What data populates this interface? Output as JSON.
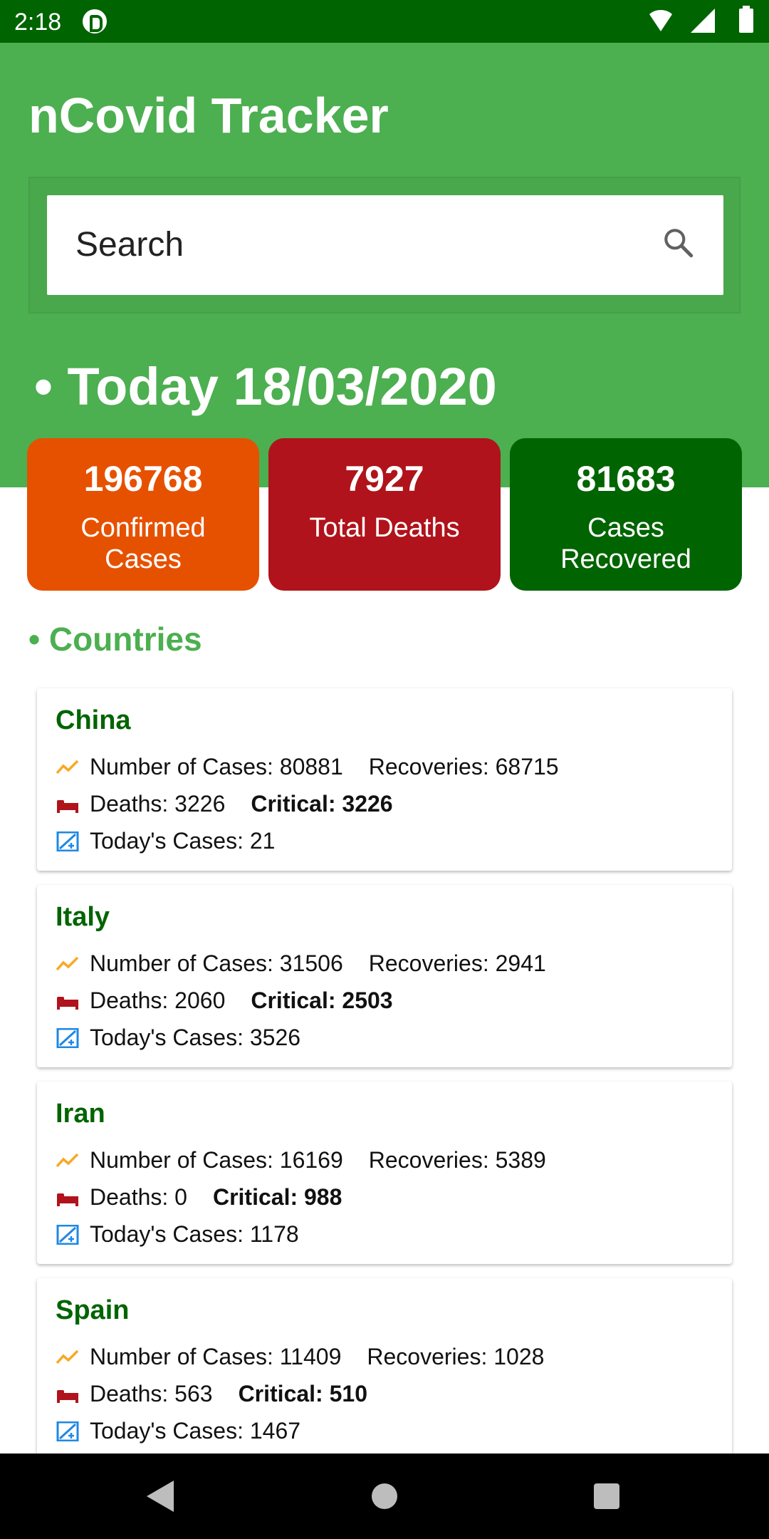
{
  "status_bar": {
    "time": "2:18"
  },
  "app": {
    "title": "nCovid Tracker"
  },
  "search": {
    "label": "Search"
  },
  "today": {
    "label": "• Today 18/03/2020"
  },
  "stats": {
    "confirmed": {
      "value": "196768",
      "label": "Confirmed Cases"
    },
    "deaths": {
      "value": "7927",
      "label": "Total Deaths"
    },
    "recovered": {
      "value": "81683",
      "label": "Cases Recovered"
    }
  },
  "countries_heading": "• Countries",
  "labels": {
    "cases": "Number of Cases:",
    "recoveries": "Recoveries:",
    "deaths": "Deaths:",
    "critical": "Critical:",
    "today": "Today's Cases:"
  },
  "countries": [
    {
      "name": "China",
      "cases": "80881",
      "recoveries": "68715",
      "deaths": "3226",
      "critical": "3226",
      "today": "21"
    },
    {
      "name": "Italy",
      "cases": "31506",
      "recoveries": "2941",
      "deaths": "2060",
      "critical": "2503",
      "today": "3526"
    },
    {
      "name": "Iran",
      "cases": "16169",
      "recoveries": "5389",
      "deaths": "0",
      "critical": "988",
      "today": "1178"
    },
    {
      "name": "Spain",
      "cases": "11409",
      "recoveries": "1028",
      "deaths": "563",
      "critical": "510",
      "today": "1467"
    }
  ],
  "colors": {
    "header_green": "#4caf50",
    "dark_green": "#006400",
    "confirmed_orange": "#e65100",
    "deaths_red": "#b0131b",
    "trend_icon": "#f9a825",
    "bed_icon": "#b0131b",
    "today_icon": "#1e88e5"
  },
  "icons": {
    "row_cases": "trending-up-icon",
    "row_deaths": "bed-icon",
    "row_today": "calendar-add-icon"
  }
}
